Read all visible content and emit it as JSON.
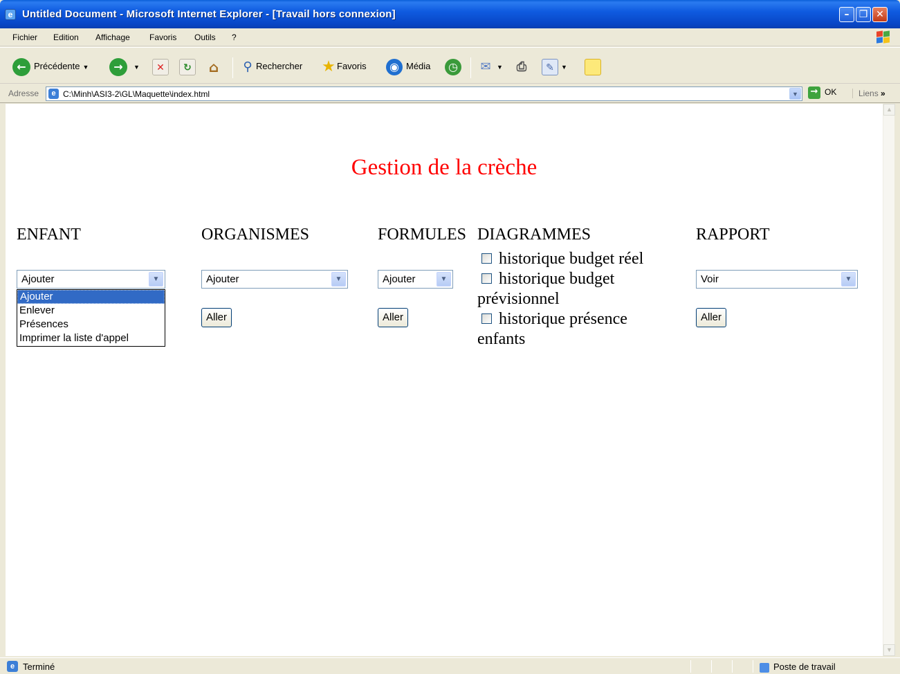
{
  "window": {
    "title": "Untitled Document - Microsoft Internet Explorer - [Travail hors connexion]"
  },
  "menu": [
    "Fichier",
    "Edition",
    "Affichage",
    "Favoris",
    "Outils",
    "?"
  ],
  "toolbar": {
    "back_label": "Précédente",
    "search_label": "Rechercher",
    "favorites_label": "Favoris",
    "media_label": "Média"
  },
  "address": {
    "label": "Adresse",
    "value": "C:\\Minh\\ASI3-2\\GL\\Maquette\\index.html",
    "go_label": "OK",
    "links_label": "Liens"
  },
  "page": {
    "title": "Gestion de la crèche",
    "title_color": "#ff0000",
    "columns": {
      "enfant": {
        "heading": "ENFANT",
        "select_value": "Ajouter",
        "options": [
          "Ajouter",
          "Enlever",
          "Présences",
          "Imprimer la liste d'appel"
        ],
        "highlighted_option": "Ajouter"
      },
      "organismes": {
        "heading": "ORGANISMES",
        "select_value": "Ajouter",
        "button_label": "Aller"
      },
      "formules": {
        "heading": "FORMULES",
        "select_value": "Ajouter",
        "button_label": "Aller"
      },
      "diagrammes": {
        "heading": "DIAGRAMMES",
        "checkboxes": [
          {
            "label": "historique budget réel",
            "checked": false
          },
          {
            "label": "historique budget prévisionnel",
            "checked": false
          },
          {
            "label": "historique présence enfants",
            "checked": false
          }
        ]
      },
      "rapport": {
        "heading": "RAPPORT",
        "select_value": "Voir",
        "button_label": "Aller"
      }
    }
  },
  "status": {
    "text": "Terminé",
    "zone": "Poste de travail"
  }
}
